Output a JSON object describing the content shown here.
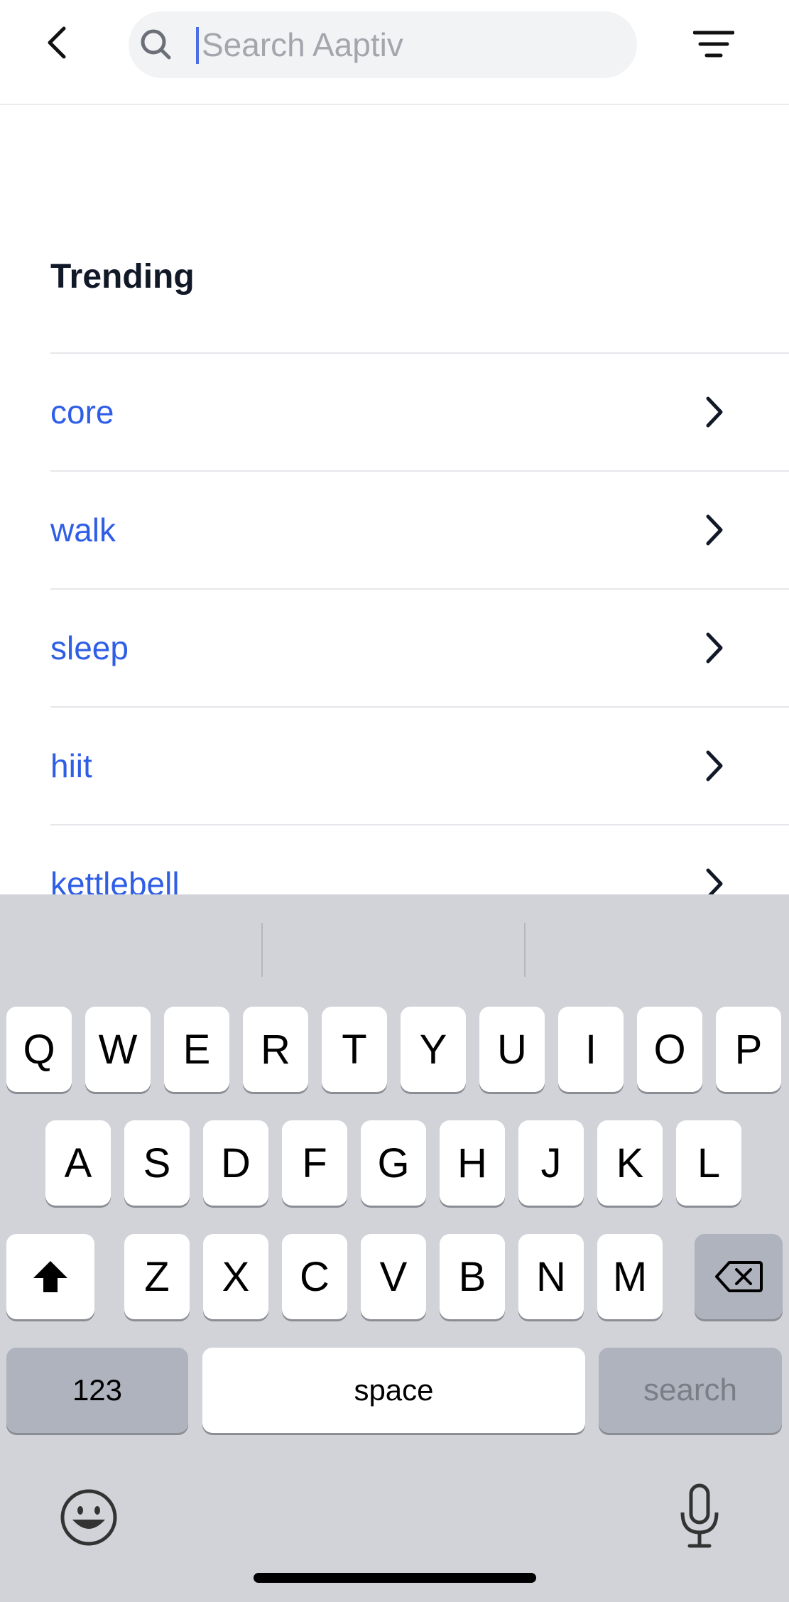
{
  "header": {
    "search_placeholder": "Search Aaptiv",
    "search_value": ""
  },
  "trending": {
    "title": "Trending",
    "items": [
      {
        "label": "core"
      },
      {
        "label": "walk"
      },
      {
        "label": "sleep"
      },
      {
        "label": "hiit"
      },
      {
        "label": "kettlebell"
      }
    ]
  },
  "keyboard": {
    "row1": [
      "Q",
      "W",
      "E",
      "R",
      "T",
      "Y",
      "U",
      "I",
      "O",
      "P"
    ],
    "row2": [
      "A",
      "S",
      "D",
      "F",
      "G",
      "H",
      "J",
      "K",
      "L"
    ],
    "row3": [
      "Z",
      "X",
      "C",
      "V",
      "B",
      "N",
      "M"
    ],
    "numbers_label": "123",
    "space_label": "space",
    "search_label": "search"
  },
  "colors": {
    "link": "#2f5ee6",
    "keyboard_bg": "#d1d3d9",
    "search_field_bg": "#f2f3f5"
  },
  "icons": [
    "back-arrow-icon",
    "search-icon",
    "filter-icon",
    "chevron-right-icon",
    "shift-icon",
    "backspace-icon",
    "emoji-icon",
    "microphone-icon"
  ]
}
